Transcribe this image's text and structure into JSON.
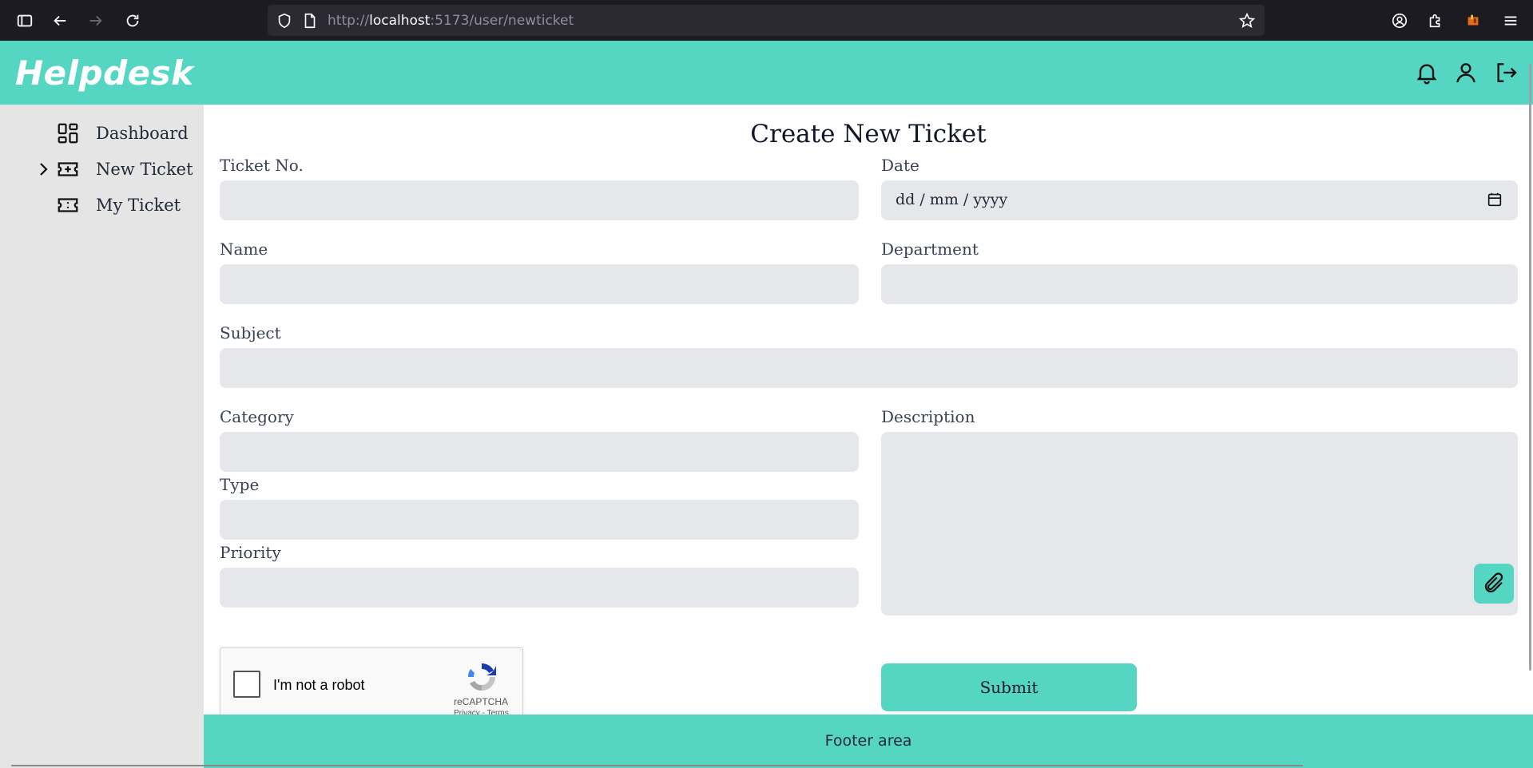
{
  "browser": {
    "url_prefix": "http://",
    "url_host": "localhost",
    "url_path": ":5173/user/newticket",
    "icons": [
      "sidebar-toggle-icon",
      "back-icon",
      "forward-icon",
      "reload-icon",
      "shield-icon",
      "page-icon",
      "bookmark-star-icon",
      "account-icon",
      "extensions-icon",
      "extension-fire-icon",
      "menu-icon"
    ]
  },
  "header": {
    "brand": "Helpdesk",
    "icons": [
      "bell-icon",
      "user-icon",
      "logout-icon"
    ],
    "accent_color": "#55d6c2"
  },
  "sidebar": {
    "items": [
      {
        "label": "Dashboard",
        "icon": "dashboard-grid-icon",
        "active": false
      },
      {
        "label": "New Ticket",
        "icon": "ticket-plus-icon",
        "active": true
      },
      {
        "label": "My Ticket",
        "icon": "ticket-icon",
        "active": false
      }
    ]
  },
  "form": {
    "title": "Create New Ticket",
    "ticket_no_label": "Ticket No.",
    "ticket_no_value": "",
    "date_label": "Date",
    "date_placeholder": "dd / mm / yyyy",
    "name_label": "Name",
    "name_value": "",
    "department_label": "Department",
    "department_value": "",
    "subject_label": "Subject",
    "subject_value": "",
    "category_label": "Category",
    "category_value": "",
    "type_label": "Type",
    "type_value": "",
    "priority_label": "Priority",
    "priority_value": "",
    "description_label": "Description",
    "description_value": "",
    "attach_icon": "paperclip-icon",
    "submit_label": "Submit"
  },
  "captcha": {
    "text": "I'm not a robot",
    "brand": "reCAPTCHA",
    "links": "Privacy - Terms"
  },
  "footer": {
    "text": "Footer area"
  }
}
